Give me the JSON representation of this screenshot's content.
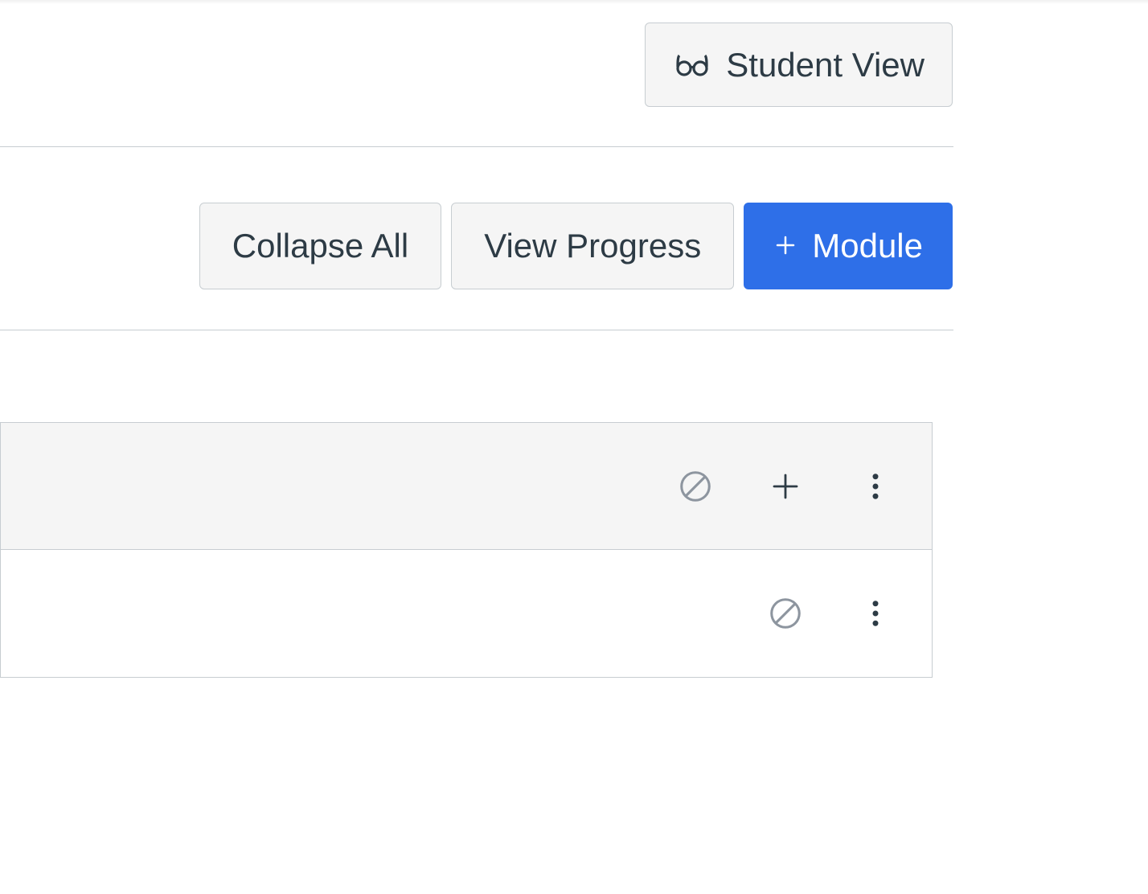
{
  "header": {
    "student_view_label": "Student View"
  },
  "toolbar": {
    "collapse_all_label": "Collapse All",
    "view_progress_label": "View Progress",
    "add_module_label": "Module"
  },
  "colors": {
    "primary": "#2e6fe8",
    "border": "#c7cdd1",
    "text": "#2d3b45",
    "muted": "#6b7780",
    "panel": "#f5f5f5"
  }
}
